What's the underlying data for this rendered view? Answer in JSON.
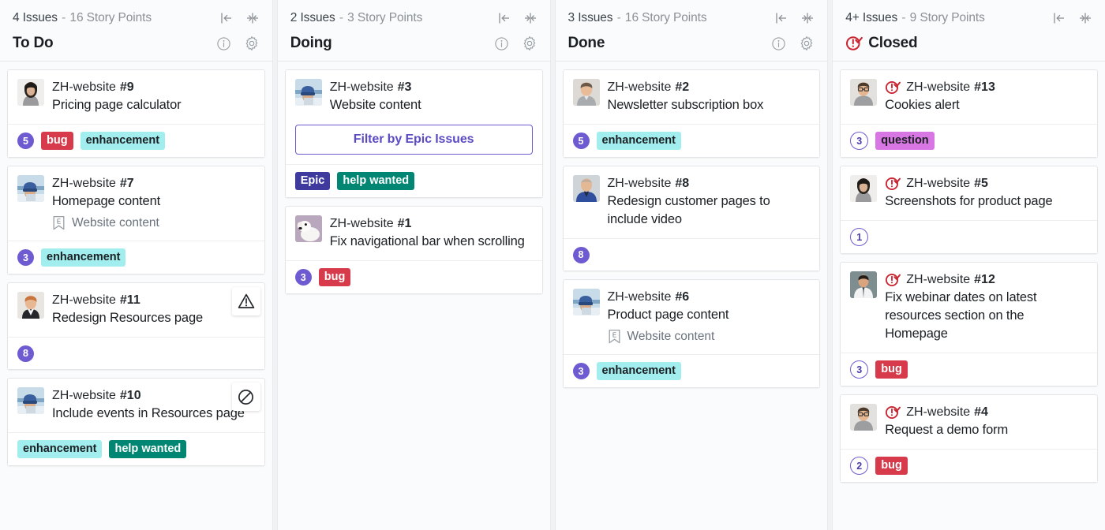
{
  "theme": {
    "board_bg": "#f1f2f4",
    "column_bg": "#fafbfc",
    "card_bg": "#ffffff",
    "story_point_purple": "#6f5bd1",
    "closed_red": "#cb2431"
  },
  "labels_palette": {
    "bug": {
      "bg": "#d73a4a",
      "fg": "#ffffff"
    },
    "enhancement": {
      "bg": "#a2eeef",
      "fg": "#1b1f23"
    },
    "help wanted": {
      "bg": "#008672",
      "fg": "#ffffff"
    },
    "Epic": {
      "bg": "#3f3b9e",
      "fg": "#ffffff"
    },
    "question": {
      "bg": "#d876e3",
      "fg": "#1b1f23"
    }
  },
  "columns": [
    {
      "id": "todo",
      "stats": {
        "issues": "4 Issues",
        "dash": "-",
        "points": "16 Story Points"
      },
      "title": "To Do",
      "closed_icon": false,
      "has_info_gear": true,
      "cards": [
        {
          "ref_repo": "ZH-website",
          "ref_num": "#9",
          "title": "Pricing page calculator",
          "avatar": "avatar-woman-dark-hair",
          "closed_icon": false,
          "epic": null,
          "corner_badge": null,
          "points": "5",
          "points_outline": false,
          "labels": [
            "bug",
            "enhancement"
          ],
          "epic_button": null
        },
        {
          "ref_repo": "ZH-website",
          "ref_num": "#7",
          "title": "Homepage content",
          "avatar": "avatar-winter-hat",
          "closed_icon": false,
          "epic": "Website content",
          "corner_badge": null,
          "points": "3",
          "points_outline": false,
          "labels": [
            "enhancement"
          ],
          "epic_button": null
        },
        {
          "ref_repo": "ZH-website",
          "ref_num": "#11",
          "title": "Redesign Resources page",
          "avatar": "avatar-man-suit",
          "closed_icon": false,
          "epic": null,
          "corner_badge": "warning-triangle-icon",
          "points": "8",
          "points_outline": false,
          "labels": [],
          "epic_button": null
        },
        {
          "ref_repo": "ZH-website",
          "ref_num": "#10",
          "title": "Include events in Resources page",
          "avatar": "avatar-winter-hat",
          "closed_icon": false,
          "epic": null,
          "corner_badge": "blocked-icon",
          "points": null,
          "points_outline": false,
          "labels": [
            "enhancement",
            "help wanted"
          ],
          "epic_button": null
        }
      ]
    },
    {
      "id": "doing",
      "stats": {
        "issues": "2 Issues",
        "dash": "-",
        "points": "3 Story Points"
      },
      "title": "Doing",
      "closed_icon": false,
      "has_info_gear": true,
      "cards": [
        {
          "ref_repo": "ZH-website",
          "ref_num": "#3",
          "title": "Website content",
          "avatar": "avatar-winter-hat",
          "closed_icon": false,
          "epic": null,
          "corner_badge": null,
          "points": null,
          "points_outline": false,
          "labels": [
            "Epic",
            "help wanted"
          ],
          "epic_button": "Filter by Epic Issues"
        },
        {
          "ref_repo": "ZH-website",
          "ref_num": "#1",
          "title": "Fix navigational bar when scrolling",
          "avatar": "avatar-dog",
          "closed_icon": false,
          "epic": null,
          "corner_badge": null,
          "points": "3",
          "points_outline": false,
          "labels": [
            "bug"
          ],
          "epic_button": null
        }
      ]
    },
    {
      "id": "done",
      "stats": {
        "issues": "3 Issues",
        "dash": "-",
        "points": "16 Story Points"
      },
      "title": "Done",
      "closed_icon": false,
      "has_info_gear": true,
      "cards": [
        {
          "ref_repo": "ZH-website",
          "ref_num": "#2",
          "title": "Newsletter subscription box",
          "avatar": "avatar-man-grey-shirt",
          "closed_icon": false,
          "epic": null,
          "corner_badge": null,
          "points": "5",
          "points_outline": false,
          "labels": [
            "enhancement"
          ],
          "epic_button": null
        },
        {
          "ref_repo": "ZH-website",
          "ref_num": "#8",
          "title": "Redesign customer pages to include video",
          "avatar": "avatar-man-blue-jacket",
          "closed_icon": false,
          "epic": null,
          "corner_badge": null,
          "points": "8",
          "points_outline": false,
          "labels": [],
          "epic_button": null
        },
        {
          "ref_repo": "ZH-website",
          "ref_num": "#6",
          "title": "Product page content",
          "avatar": "avatar-winter-hat",
          "closed_icon": false,
          "epic": "Website content",
          "corner_badge": null,
          "points": "3",
          "points_outline": false,
          "labels": [
            "enhancement"
          ],
          "epic_button": null
        }
      ]
    },
    {
      "id": "closed",
      "stats": {
        "issues": "4+ Issues",
        "dash": "-",
        "points": "9 Story Points"
      },
      "title": "Closed",
      "closed_icon": true,
      "has_info_gear": false,
      "cards": [
        {
          "ref_repo": "ZH-website",
          "ref_num": "#13",
          "title": "Cookies alert",
          "avatar": "avatar-man-glasses",
          "closed_icon": true,
          "epic": null,
          "corner_badge": null,
          "points": "3",
          "points_outline": true,
          "labels": [
            "question"
          ],
          "epic_button": null
        },
        {
          "ref_repo": "ZH-website",
          "ref_num": "#5",
          "title": "Screenshots for product page",
          "avatar": "avatar-woman-dark-hair",
          "closed_icon": true,
          "epic": null,
          "corner_badge": null,
          "points": "1",
          "points_outline": true,
          "labels": [],
          "epic_button": null
        },
        {
          "ref_repo": "ZH-website",
          "ref_num": "#12",
          "title": "Fix webinar dates on latest resources section on the Homepage",
          "avatar": "avatar-lab-coat",
          "closed_icon": true,
          "epic": null,
          "corner_badge": null,
          "points": "3",
          "points_outline": true,
          "labels": [
            "bug"
          ],
          "epic_button": null
        },
        {
          "ref_repo": "ZH-website",
          "ref_num": "#4",
          "title": "Request a demo form",
          "avatar": "avatar-man-glasses",
          "closed_icon": true,
          "epic": null,
          "corner_badge": null,
          "points": "2",
          "points_outline": true,
          "labels": [
            "bug"
          ],
          "epic_button": null
        }
      ]
    }
  ]
}
